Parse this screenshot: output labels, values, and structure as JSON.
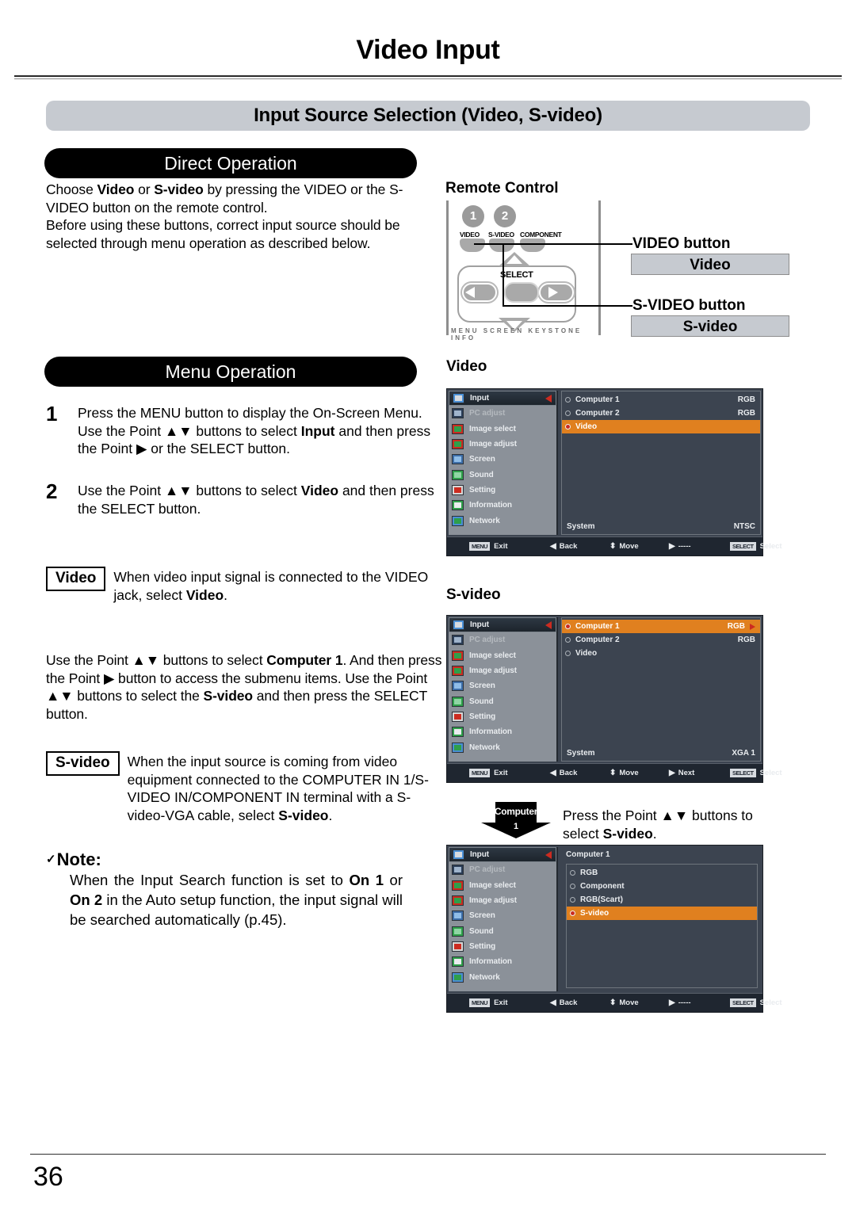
{
  "page": {
    "title": "Video Input",
    "section_title": "Input Source Selection (Video, S-video)",
    "number": "36"
  },
  "direct_operation": {
    "pill_label": "Direct Operation",
    "paragraph_1_pre": "Choose ",
    "paragraph_1_b1": "Video",
    "paragraph_1_mid": " or ",
    "paragraph_1_b2": "S-video",
    "paragraph_1_post": " by pressing the VIDEO or the S-VIDEO button on the remote control.",
    "paragraph_2": "Before using these buttons, correct input source should be selected through menu operation as described below."
  },
  "remote": {
    "heading": "Remote Control",
    "badge_1": "1",
    "badge_2": "2",
    "key_video": "VIDEO",
    "key_svideo": "S-VIDEO",
    "key_component": "COMPONENT",
    "select_label": "SELECT",
    "bottom_labels": "MENU  SCREEN  KEYSTONE  INFO",
    "callout_video_title": "VIDEO button",
    "callout_video_value": "Video",
    "callout_svideo_title": "S-VIDEO button",
    "callout_svideo_value": "S-video"
  },
  "menu_operation": {
    "pill_label": "Menu Operation",
    "steps": [
      {
        "num": "1",
        "pre": "Press the MENU button to display the On-Screen Menu. Use the Point ▲▼ buttons to select ",
        "bold": "Input",
        "post": " and then press the Point ▶ or the SELECT button."
      },
      {
        "num": "2",
        "pre": "Use the Point ▲▼ buttons to select ",
        "bold": "Video",
        "post": " and then press the SELECT button."
      }
    ],
    "video_box_label": "Video",
    "video_box_text_pre": "When video input signal is connected to the VIDEO jack, select ",
    "video_box_text_bold": "Video",
    "video_box_text_post": ".",
    "computer1_paragraph_pre": "Use the Point ▲▼ buttons to select ",
    "computer1_paragraph_b1": "Computer 1",
    "computer1_paragraph_mid": ". And then press the Point ▶ button to access the submenu items. Use the Point ▲▼ buttons to select the ",
    "computer1_paragraph_b2": "S-video",
    "computer1_paragraph_post": " and then press the SELECT button.",
    "svideo_box_label": "S-video",
    "svideo_box_text_pre": "When the input source is coming from video equipment connected to the COMPUTER IN 1/S-VIDEO IN/COMPONENT IN terminal with a S-video-VGA cable, select ",
    "svideo_box_text_bold": "S-video",
    "svideo_box_text_post": "."
  },
  "note": {
    "check": "✓",
    "heading": "Note:",
    "body_pre": "When the Input Search function is set to ",
    "body_b1": "On 1",
    "body_mid": " or ",
    "body_b2": "On 2",
    "body_post": " in the Auto setup function, the input signal will be searched automatically (p.45)."
  },
  "osd_common": {
    "sidebar": [
      {
        "label": "Input",
        "icon": "input-icon"
      },
      {
        "label": "PC adjust",
        "icon": "pc-adjust-icon"
      },
      {
        "label": "Image select",
        "icon": "image-select-icon"
      },
      {
        "label": "Image adjust",
        "icon": "image-adjust-icon"
      },
      {
        "label": "Screen",
        "icon": "screen-icon"
      },
      {
        "label": "Sound",
        "icon": "sound-icon"
      },
      {
        "label": "Setting",
        "icon": "setting-icon"
      },
      {
        "label": "Information",
        "icon": "information-icon"
      },
      {
        "label": "Network",
        "icon": "network-icon"
      }
    ],
    "bar": {
      "menu_key": "MENU",
      "exit": "Exit",
      "back_glyph": "◀",
      "back": "Back",
      "move_glyph": "⬍",
      "move": "Move",
      "next_glyph": "▶",
      "select_key": "SELECT",
      "select": "Select"
    }
  },
  "osd_video": {
    "caption": "Video",
    "rows": [
      {
        "label": "Computer 1",
        "value": "RGB",
        "selected": false,
        "radio_on": false
      },
      {
        "label": "Computer 2",
        "value": "RGB",
        "selected": false,
        "radio_on": false
      },
      {
        "label": "Video",
        "value": "",
        "selected": true,
        "radio_on": true
      }
    ],
    "system_label": "System",
    "system_value": "NTSC",
    "bar_next_text": "-----"
  },
  "osd_svideo": {
    "caption": "S-video",
    "rows": [
      {
        "label": "Computer 1",
        "value": "RGB",
        "selected": true,
        "radio_on": true
      },
      {
        "label": "Computer 2",
        "value": "RGB",
        "selected": false,
        "radio_on": false
      },
      {
        "label": "Video",
        "value": "",
        "selected": false,
        "radio_on": false
      }
    ],
    "system_label": "System",
    "system_value": "XGA 1",
    "bar_next_text": "Next"
  },
  "osd_submenu": {
    "title": "Computer 1",
    "rows": [
      {
        "label": "RGB",
        "selected": false,
        "radio_on": false
      },
      {
        "label": "Component",
        "selected": false,
        "radio_on": false
      },
      {
        "label": "RGB(Scart)",
        "selected": false,
        "radio_on": false
      },
      {
        "label": "S-video",
        "selected": true,
        "radio_on": true
      }
    ],
    "bar_next_text": "-----"
  },
  "computer1_callout": {
    "line1": "Computer",
    "line2": "1",
    "text_pre": "Press the Point ▲▼ buttons to select ",
    "text_bold": "S-video",
    "text_post": "."
  },
  "colors": {
    "accent_orange": "#e0801f",
    "section_gray": "#c6cad0",
    "osd_sidebar": "#8b9199",
    "osd_panel": "#3c4450",
    "red_marker": "#cc2b20"
  }
}
